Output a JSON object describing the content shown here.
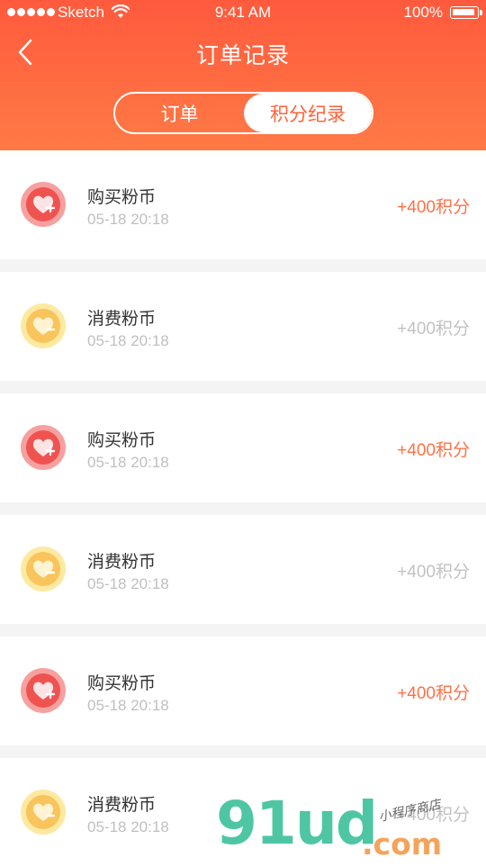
{
  "status_bar": {
    "carrier": "Sketch",
    "time": "9:41 AM",
    "battery": "100%"
  },
  "nav": {
    "title": "订单记录"
  },
  "segment": {
    "tabs": [
      {
        "label": "订单",
        "active": false
      },
      {
        "label": "积分纪录",
        "active": true
      }
    ]
  },
  "records": [
    {
      "type": "buy",
      "title": "购买粉币",
      "date": "05-18 20:18",
      "amount": "+400积分"
    },
    {
      "type": "spend",
      "title": "消费粉币",
      "date": "05-18 20:18",
      "amount": "+400积分"
    },
    {
      "type": "buy",
      "title": "购买粉币",
      "date": "05-18 20:18",
      "amount": "+400积分"
    },
    {
      "type": "spend",
      "title": "消费粉币",
      "date": "05-18 20:18",
      "amount": "+400积分"
    },
    {
      "type": "buy",
      "title": "购买粉币",
      "date": "05-18 20:18",
      "amount": "+400积分"
    },
    {
      "type": "spend",
      "title": "消费粉币",
      "date": "05-18 20:18",
      "amount": "+400积分"
    }
  ],
  "colors": {
    "header_top": "#ff5a3d",
    "header_bottom": "#ff7a45",
    "buy_amount": "#ff7146",
    "spend_amount": "#c2c2c2"
  },
  "icons": {
    "buy": "heart-plus-coin-icon",
    "spend": "heart-minus-coin-icon"
  },
  "watermark": {
    "brand": "91ud",
    "tld": ".com",
    "tagline": "小程序商店"
  }
}
